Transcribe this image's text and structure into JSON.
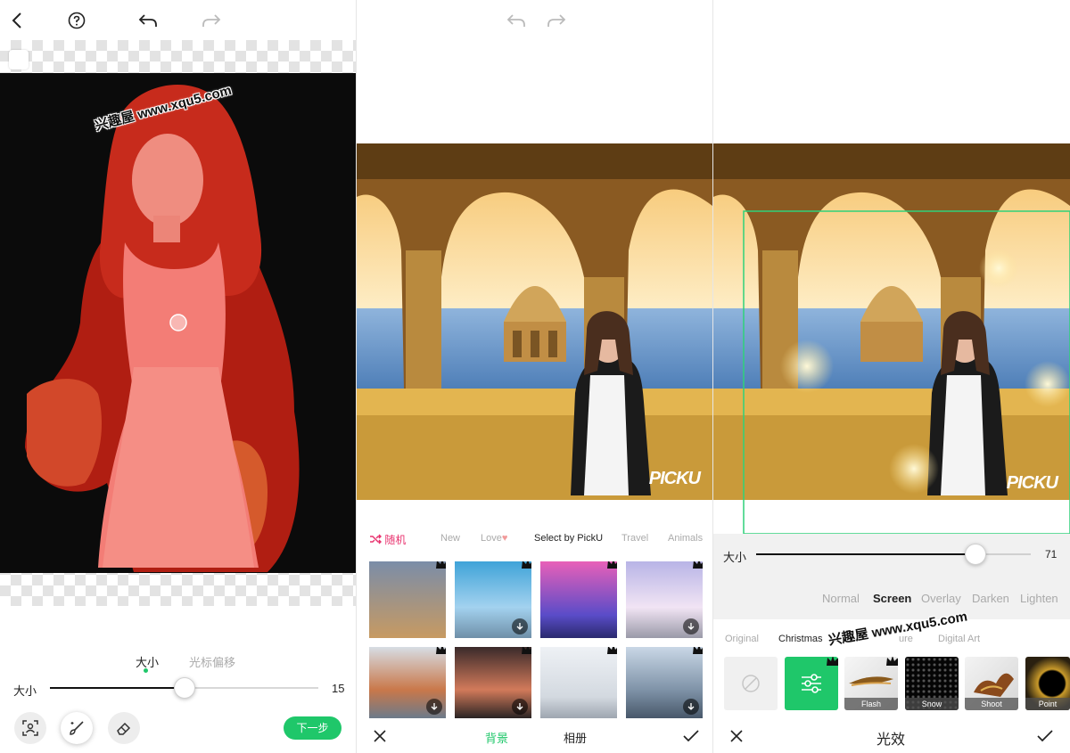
{
  "panel1": {
    "size_tabs": [
      "大小",
      "光标偏移"
    ],
    "slider_label": "大小",
    "slider_value": "15",
    "slider_fraction": 0.5,
    "next_button": "下一步",
    "watermark": "兴趣屋 www.xqu5.com"
  },
  "panel2": {
    "categories": {
      "random": "随机",
      "new": "New",
      "love": "Love",
      "select": "Select by PickU",
      "travel": "Travel",
      "animals": "Animals"
    },
    "logo": "PICKU",
    "bottom_tabs": {
      "background": "背景",
      "album": "相册"
    },
    "colors": {
      "accent": "#e8326e",
      "green": "#1fc76a"
    }
  },
  "panel3": {
    "slider_label": "大小",
    "slider_value": "71",
    "slider_fraction": 0.8,
    "blend_modes": [
      "Normal",
      "Screen",
      "Overlay",
      "Darken",
      "Lighten"
    ],
    "selected_mode": "Screen",
    "fx_categories": [
      "Original",
      "Christmas",
      "Dre",
      "ure",
      "Digital Art"
    ],
    "fx_items": [
      "Flash",
      "Snow",
      "Shoot",
      "Point"
    ],
    "bottom_title": "光效",
    "watermark": "兴趣屋 www.xqu5.com",
    "logo": "PICKU"
  }
}
